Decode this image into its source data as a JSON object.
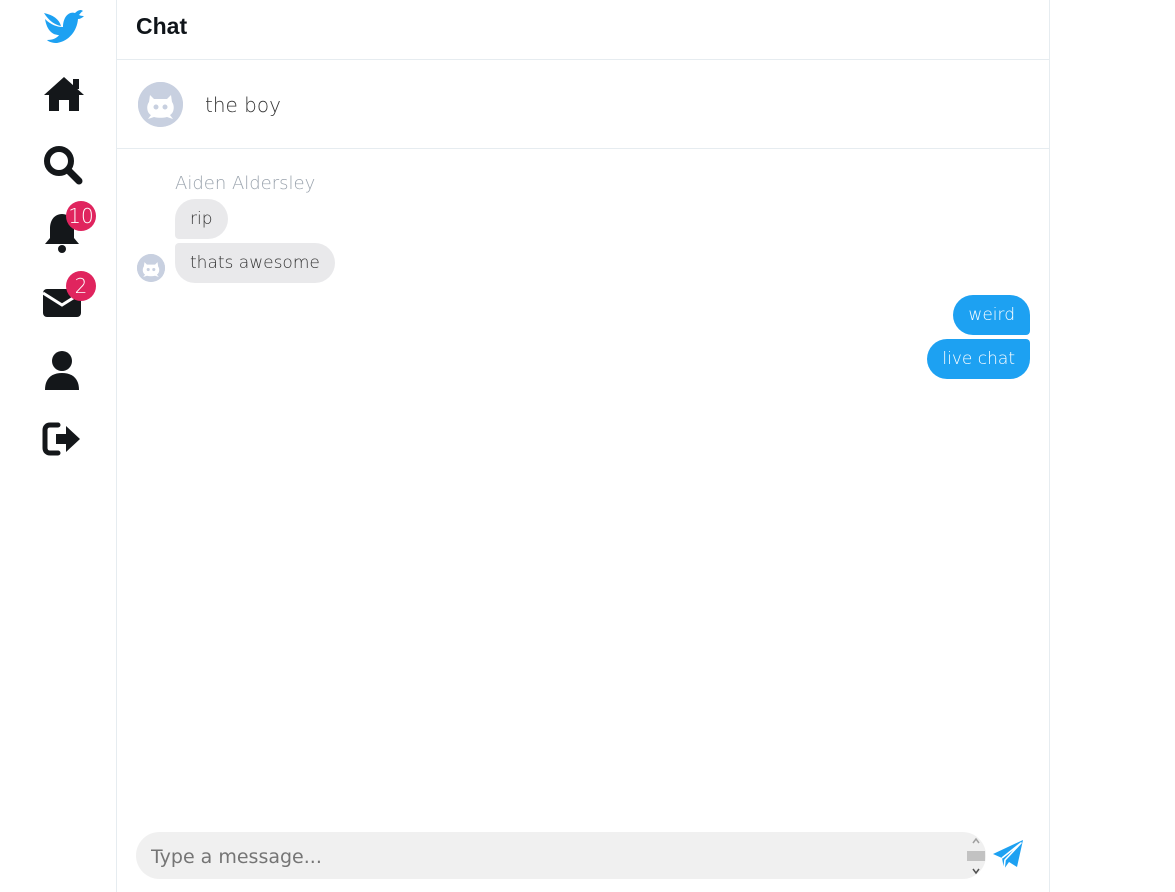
{
  "sidebar": {
    "notifications_count": "10",
    "messages_count": "2"
  },
  "header": {
    "title": "Chat"
  },
  "chat": {
    "name": "the boy",
    "sender_name": "Aiden Aldersley",
    "incoming": [
      "rip",
      "thats awesome"
    ],
    "outgoing": [
      "weird",
      "live chat"
    ]
  },
  "composer": {
    "placeholder": "Type a message..."
  },
  "colors": {
    "accent": "#1da1f2",
    "badge": "#e0245e",
    "incoming_bubble": "#e9e9eb"
  }
}
